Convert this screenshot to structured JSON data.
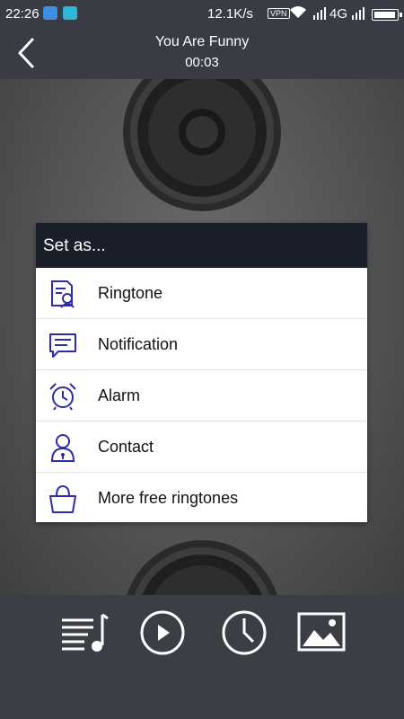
{
  "status_bar": {
    "time": "22:26",
    "speed": "12.1K/s",
    "vpn": "VPN",
    "network": "4G",
    "battery_level": 0.95
  },
  "header": {
    "title": "You Are Funny",
    "elapsed": "00:03"
  },
  "dialog": {
    "title": "Set as...",
    "accent_color": "#2c2ca8",
    "options": [
      {
        "label": "Ringtone",
        "icon": "ringtone-icon"
      },
      {
        "label": "Notification",
        "icon": "notification-icon"
      },
      {
        "label": "Alarm",
        "icon": "alarm-clock-icon"
      },
      {
        "label": "Contact",
        "icon": "contact-icon"
      },
      {
        "label": "More free ringtones",
        "icon": "shopping-bag-icon"
      }
    ]
  },
  "bottom_bar": {
    "buttons": [
      "playlist-icon",
      "play-icon",
      "clock-icon",
      "image-icon"
    ]
  }
}
